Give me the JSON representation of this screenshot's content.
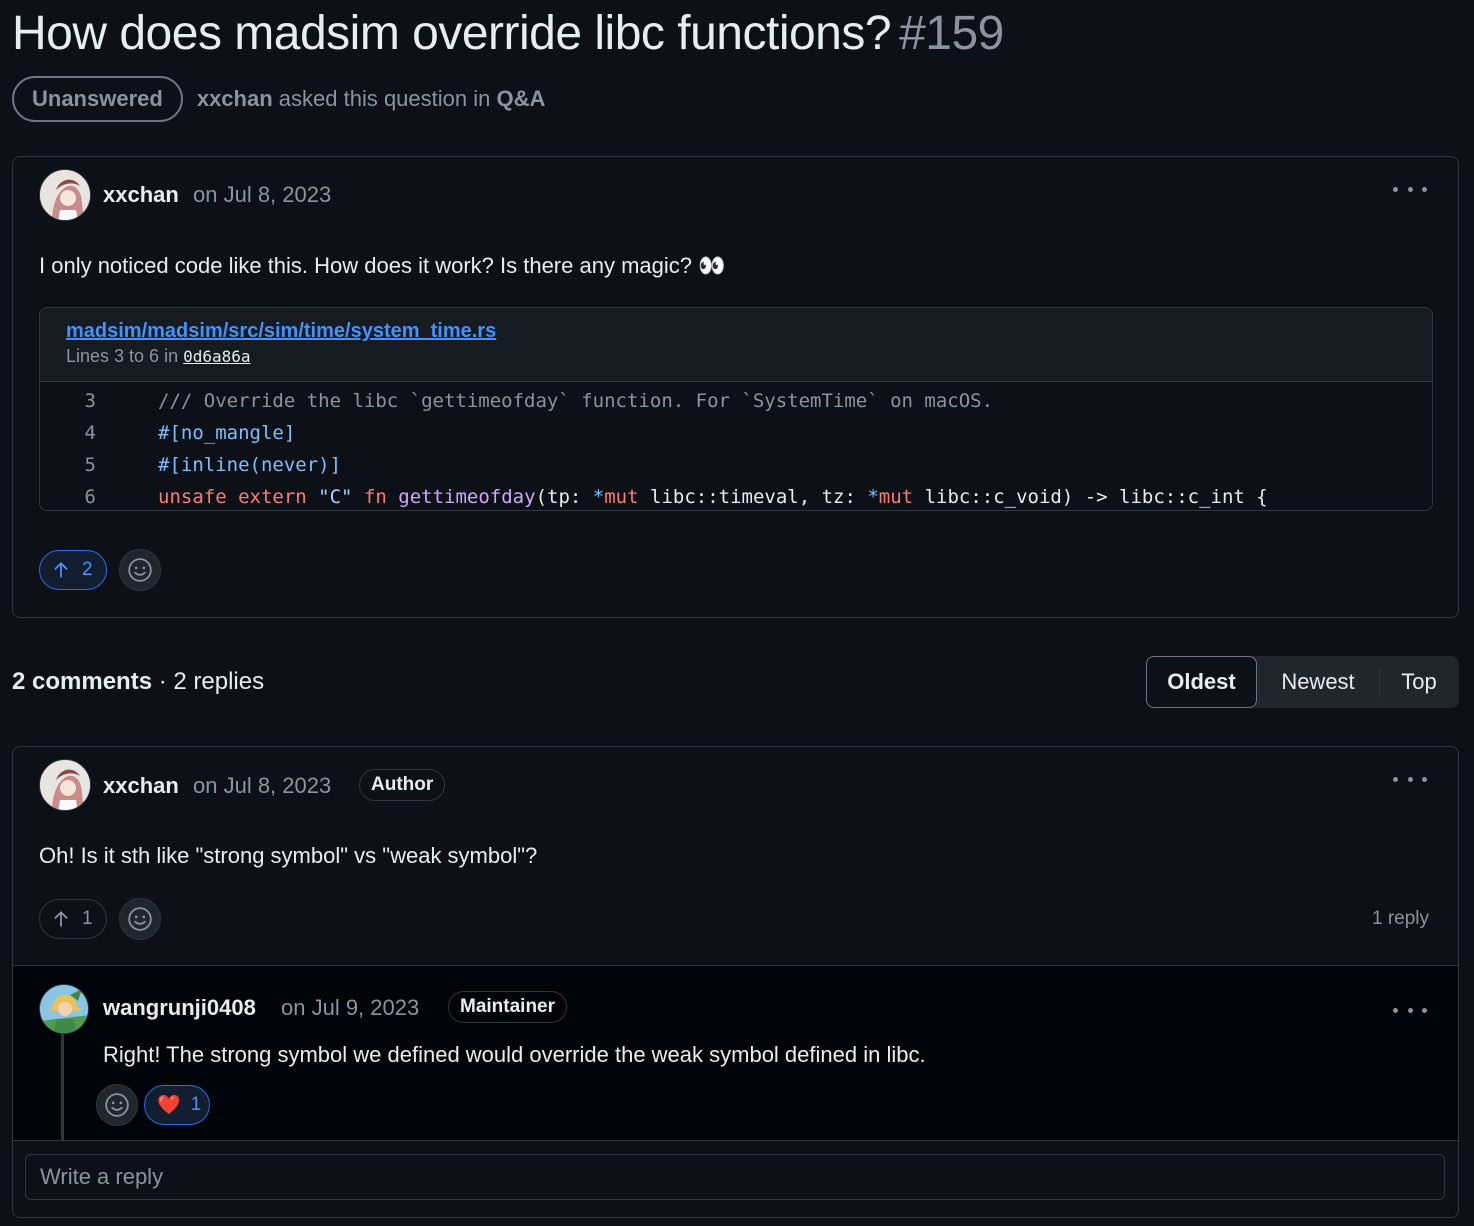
{
  "discussion": {
    "title": "How does madsim override libc functions?",
    "number": "#159",
    "state": "Unanswered",
    "asker": "xxchan",
    "asked_text": "asked this question in",
    "category": "Q&A"
  },
  "question": {
    "author": "xxchan",
    "date": "on Jul 8, 2023",
    "body": "I only noticed code like this. How does it work? Is there any magic? 👀",
    "embed": {
      "path": "madsim/madsim/src/sim/time/system_time.rs",
      "lines_prefix": "Lines 3 to 6 in",
      "sha": "0d6a86a",
      "line_numbers": [
        "3",
        "4",
        "5",
        "6"
      ]
    },
    "upvotes": "2"
  },
  "comments_summary": {
    "comments": "2 comments",
    "separator": " · ",
    "replies": "2 replies"
  },
  "sort": {
    "options": [
      "Oldest",
      "Newest",
      "Top"
    ],
    "selected": "Oldest"
  },
  "comment": {
    "author": "xxchan",
    "date": "on Jul 8, 2023",
    "badge": "Author",
    "body": "Oh! Is it sth like \"strong symbol\" vs \"weak symbol\"?",
    "upvotes": "1",
    "reply_count": "1 reply"
  },
  "reply": {
    "author": "wangrunji0408",
    "date": "on Jul 9, 2023",
    "badge": "Maintainer",
    "body": "Right! The strong symbol we defined would override the weak symbol defined in libc.",
    "reaction_emoji": "❤️",
    "reaction_count": "1"
  },
  "reply_box": {
    "placeholder": "Write a reply"
  }
}
